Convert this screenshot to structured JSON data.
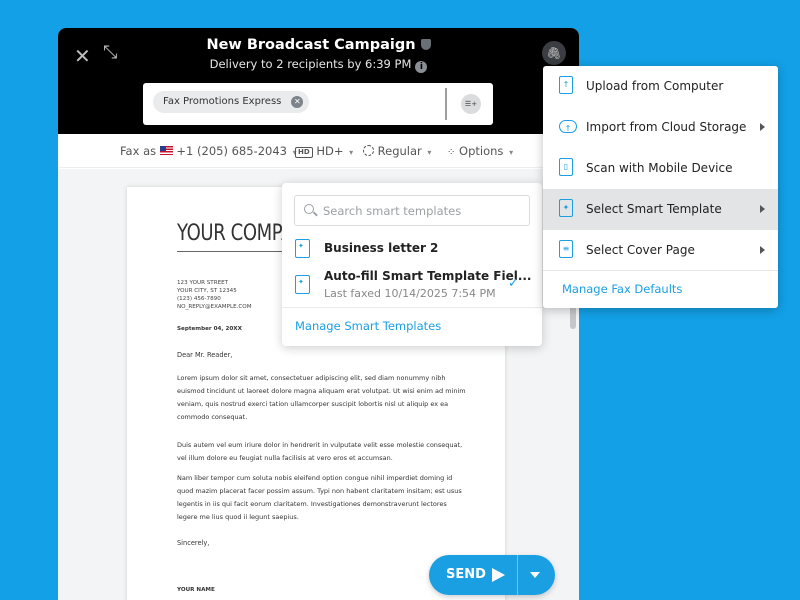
{
  "header": {
    "title": "New Broadcast Campaign",
    "subtitle": "Delivery to 2 recipients by 6:39 PM",
    "close_icon": "close-icon",
    "expand_icon": "expand-icon",
    "attach_icon": "paperclip-icon"
  },
  "recipients": {
    "chip_label": "Fax Promotions Express",
    "contacts_icon": "contacts-icon"
  },
  "toolbar": {
    "fax_as_label": "Fax as",
    "fax_number": "+1 (205) 685-2043",
    "quality": "HD+",
    "speed": "Regular",
    "options": "Options"
  },
  "document": {
    "company": "YOUR COMPA",
    "address": [
      "123 YOUR STREET",
      "YOUR CITY, ST 12345",
      "(123) 456-7890",
      "NO_REPLY@EXAMPLE.COM"
    ],
    "date": "September 04, 20XX",
    "greeting": "Dear Mr. Reader,",
    "paragraphs": [
      "Lorem ipsum dolor sit amet, consectetuer adipiscing elit, sed diam nonummy nibh euismod tincidunt ut laoreet dolore magna aliquam erat volutpat. Ut wisi enim ad minim veniam, quis nostrud exerci tation ullamcorper suscipit lobortis nisl ut aliquip ex ea commodo consequat.",
      "Duis autem vel eum iriure dolor in hendrerit in vulputate velit esse molestie consequat, vel illum dolore eu feugiat nulla facilisis at vero eros et accumsan.",
      "Nam liber tempor cum soluta nobis eleifend option congue nihil imperdiet doming id quod mazim placerat facer possim assum. Typi non habent claritatem insitam; est usus legentis in iis qui facit eorum claritatem. Investigationes demonstraverunt lectores legere me lius quod ii legunt saepius."
    ],
    "closing": "Sincerely,",
    "signature_name": "YOUR NAME"
  },
  "templates": {
    "search_placeholder": "Search smart templates",
    "items": [
      {
        "name": "Business letter 2",
        "sub": ""
      },
      {
        "name": "Auto-fill Smart Template Fiel...",
        "sub": "Last faxed 10/14/2025 7:54 PM"
      }
    ],
    "manage_label": "Manage Smart Templates"
  },
  "attach_menu": {
    "items": [
      {
        "label": "Upload from Computer",
        "icon": "upload-file-icon"
      },
      {
        "label": "Import from Cloud Storage",
        "icon": "cloud-icon"
      },
      {
        "label": "Scan with Mobile Device",
        "icon": "mobile-scan-icon"
      },
      {
        "label": "Select Smart Template",
        "icon": "smart-template-icon"
      },
      {
        "label": "Select Cover Page",
        "icon": "cover-page-icon"
      }
    ],
    "manage_label": "Manage Fax Defaults"
  },
  "send": {
    "label": "SEND"
  },
  "colors": {
    "accent": "#1b9fe3",
    "background": "#13a0e6",
    "header": "#000000"
  }
}
